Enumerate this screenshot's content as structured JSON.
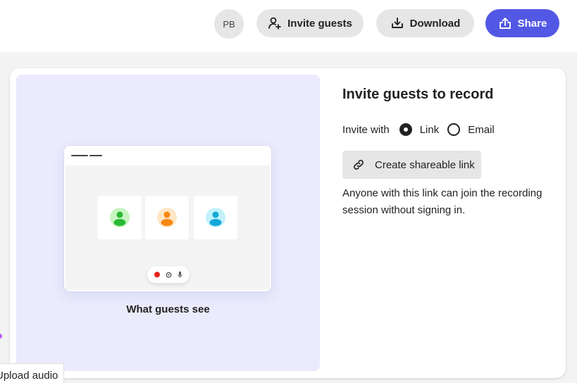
{
  "header": {
    "avatar_initials": "PB",
    "invite_label": "Invite guests",
    "download_label": "Download",
    "share_label": "Share",
    "share_color": "#5258e4"
  },
  "preview": {
    "caption": "What guests see",
    "participants": [
      {
        "icon": "user-icon",
        "color": "#2ab935",
        "bg": "#c9f5c3"
      },
      {
        "icon": "user-icon",
        "color": "#f7870f",
        "bg": "#ffe6c6"
      },
      {
        "icon": "user-icon",
        "color": "#13a9d8",
        "bg": "#c3f2fc"
      }
    ],
    "controls": [
      "record-icon",
      "settings-icon",
      "microphone-icon"
    ]
  },
  "panel": {
    "title": "Invite guests to record",
    "invite_with_label": "Invite with",
    "options": [
      {
        "label": "Link",
        "checked": true
      },
      {
        "label": "Email",
        "checked": false
      }
    ],
    "create_link_label": "Create shareable link",
    "help_text": "Anyone with this link can join the recording session without signing in."
  },
  "background": {
    "upload_tab_label": "Upload audio"
  }
}
